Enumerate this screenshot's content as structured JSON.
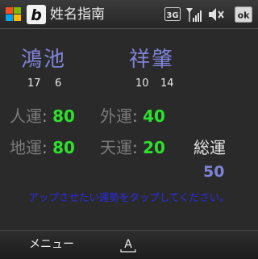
{
  "titlebar": {
    "app_title": "姓名指南",
    "logo_letter": "b",
    "network": "3G",
    "ok_label": "ok"
  },
  "names": {
    "surname": "鴻池",
    "given": "祥肇",
    "surname_strokes": [
      "17",
      "6"
    ],
    "given_strokes": [
      "10",
      "14"
    ]
  },
  "fortunes": {
    "jin_label": "人運",
    "jin_value": "80",
    "gai_label": "外運",
    "gai_value": "40",
    "chi_label": "地運",
    "chi_value": "80",
    "ten_label": "天運",
    "ten_value": "20",
    "sou_label": "総運",
    "sou_value": "50"
  },
  "instruction": "アップさせたい運勢をタップしてください。",
  "menubar": {
    "menu_label": "メニュー",
    "keyboard_letter": "A"
  },
  "colors": {
    "name": "#7f83d6",
    "value": "#2ee02e",
    "label": "#7b7b7b",
    "instruction": "#2b2be8",
    "background": "#2a2a2a"
  }
}
